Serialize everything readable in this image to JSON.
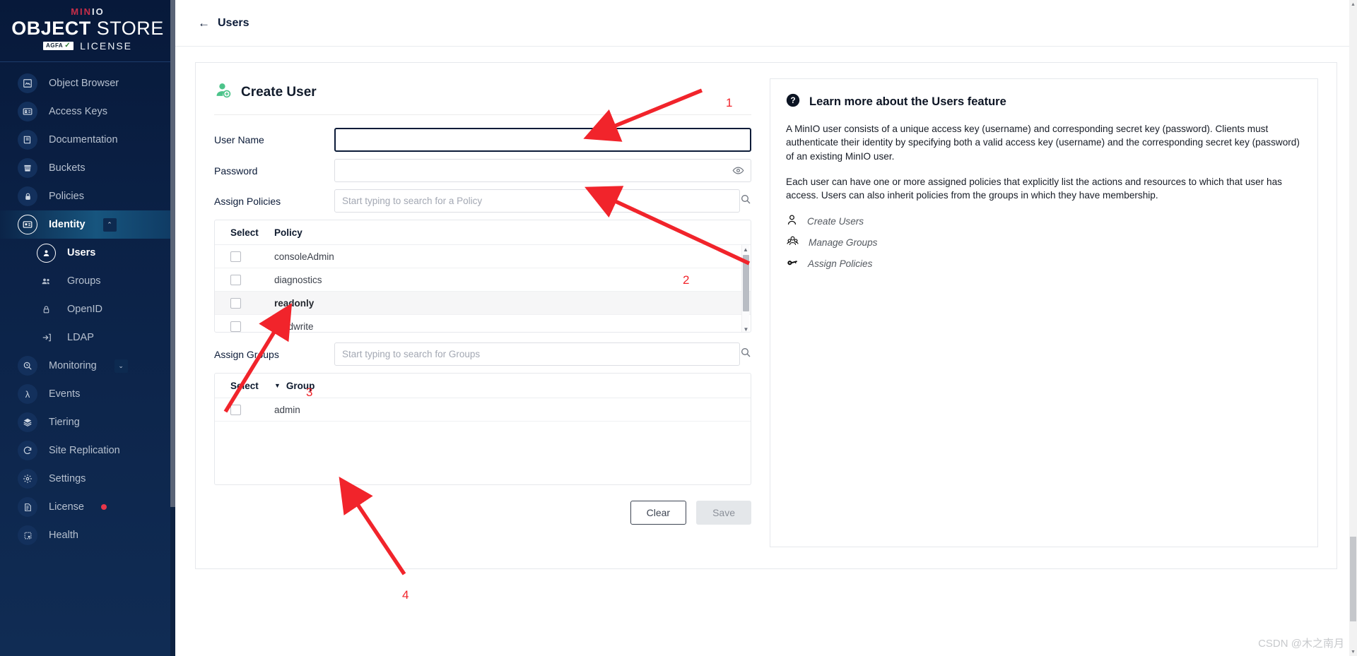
{
  "brand": {
    "minio": "MIN",
    "minio_io": "IO",
    "store_bold": "OBJECT",
    "store_light": "STORE",
    "license_logo": "AGFA",
    "license_text": "LICENSE"
  },
  "sidebar": {
    "items": [
      {
        "label": "Object Browser",
        "icon": "image-browser-icon",
        "type": "item",
        "state": ""
      },
      {
        "label": "Access Keys",
        "icon": "id-card-icon",
        "type": "item",
        "state": ""
      },
      {
        "label": "Documentation",
        "icon": "book-icon",
        "type": "item",
        "state": ""
      },
      {
        "label": "Buckets",
        "icon": "bucket-icon",
        "type": "item",
        "state": ""
      },
      {
        "label": "Policies",
        "icon": "lock-icon",
        "type": "item",
        "state": ""
      },
      {
        "label": "Identity",
        "icon": "identity-card-icon",
        "type": "item",
        "state": "active",
        "chevron": "⌃"
      },
      {
        "label": "Users",
        "icon": "user-icon",
        "type": "sub",
        "state": "selected"
      },
      {
        "label": "Groups",
        "icon": "group-icon",
        "type": "sub",
        "state": ""
      },
      {
        "label": "OpenID",
        "icon": "padlock-icon",
        "type": "sub",
        "state": ""
      },
      {
        "label": "LDAP",
        "icon": "login-arrow-icon",
        "type": "sub",
        "state": ""
      },
      {
        "label": "Monitoring",
        "icon": "magnifier-clock-icon",
        "type": "item",
        "state": "",
        "chevron": "⌄"
      },
      {
        "label": "Events",
        "icon": "lambda-icon",
        "type": "item",
        "state": ""
      },
      {
        "label": "Tiering",
        "icon": "layers-icon",
        "type": "item",
        "state": ""
      },
      {
        "label": "Site Replication",
        "icon": "replication-icon",
        "type": "item",
        "state": ""
      },
      {
        "label": "Settings",
        "icon": "gear-icon",
        "type": "item",
        "state": ""
      },
      {
        "label": "License",
        "icon": "certificate-icon",
        "type": "item",
        "state": "",
        "badge": "dot"
      },
      {
        "label": "Health",
        "icon": "health-icon",
        "type": "item",
        "state": ""
      }
    ]
  },
  "topbar": {
    "back_arrow": "←",
    "back_label": "Users"
  },
  "form": {
    "title": "Create User",
    "title_icon": "add-user-icon",
    "fields": {
      "username_label": "User Name",
      "username_value": "",
      "username_placeholder": "",
      "password_label": "Password",
      "password_value": "",
      "password_placeholder": "",
      "password_reveal_icon": "eye-icon",
      "assign_policies_label": "Assign Policies",
      "assign_policies_placeholder": "Start typing to search for a Policy",
      "assign_policies_value": "",
      "assign_groups_label": "Assign Groups",
      "assign_groups_placeholder": "Start typing to search for Groups",
      "assign_groups_value": "",
      "search_icon": "search-icon"
    },
    "policy_table": {
      "columns": [
        "Select",
        "Policy"
      ],
      "rows": [
        {
          "name": "consoleAdmin",
          "checked": false,
          "hover": false
        },
        {
          "name": "diagnostics",
          "checked": false,
          "hover": false
        },
        {
          "name": "readonly",
          "checked": false,
          "hover": true
        },
        {
          "name": "readwrite",
          "checked": false,
          "hover": false
        }
      ]
    },
    "group_table": {
      "columns": [
        "Select",
        "Group"
      ],
      "sort_caret": "▼",
      "rows": [
        {
          "name": "admin",
          "checked": false,
          "hover": false
        }
      ]
    },
    "buttons": {
      "clear": "Clear",
      "save": "Save"
    }
  },
  "help": {
    "icon": "question-mark-icon",
    "title": "Learn more about the Users feature",
    "paragraphs": [
      "A MinIO user consists of a unique access key (username) and corresponding secret key (password). Clients must authenticate their identity by specifying both a valid access key (username) and the corresponding secret key (password) of an existing MinIO user.",
      "Each user can have one or more assigned policies that explicitly list the actions and resources to which that user has access. Users can also inherit policies from the groups in which they have membership."
    ],
    "links": [
      {
        "label": "Create Users",
        "icon": "user-icon"
      },
      {
        "label": "Manage Groups",
        "icon": "group-icon"
      },
      {
        "label": "Assign Policies",
        "icon": "key-icon"
      }
    ]
  },
  "annotations": {
    "numbers": [
      "1",
      "2",
      "3",
      "4"
    ],
    "color": "#f1242b"
  },
  "watermark": "CSDN @木之南月",
  "colors": {
    "sidebar_bg": "#0b2146",
    "accent_green": "#4cc38a",
    "annotation_red": "#f1242b",
    "license_dot": "#e8374a"
  }
}
